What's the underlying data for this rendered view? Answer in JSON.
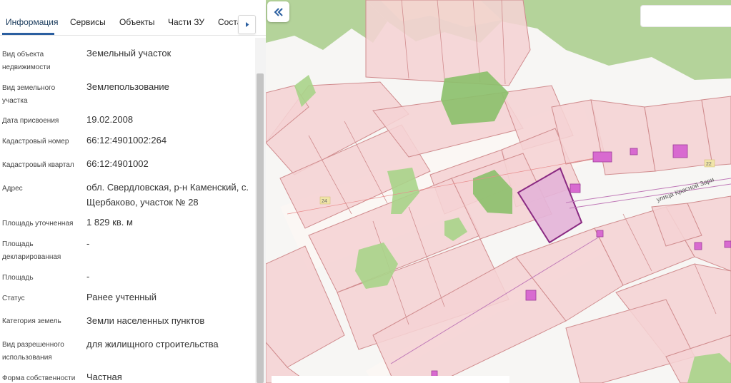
{
  "tabs": [
    {
      "label": "Информация"
    },
    {
      "label": "Сервисы"
    },
    {
      "label": "Объекты"
    },
    {
      "label": "Части ЗУ"
    },
    {
      "label": "Соста"
    }
  ],
  "properties": [
    {
      "label": "Вид объекта недвижимости",
      "value": "Земельный участок"
    },
    {
      "label": "Вид земельного участка",
      "value": "Землепользование"
    },
    {
      "label": "Дата присвоения",
      "value": "19.02.2008"
    },
    {
      "label": "Кадастровый номер",
      "value": "66:12:4901002:264"
    },
    {
      "label": "Кадастровый квартал",
      "value": "66:12:4901002"
    },
    {
      "label": "Адрес",
      "value": "обл. Свердловская, р-н Каменский, с. Щербаково, участок № 28"
    },
    {
      "label": "Площадь уточненная",
      "value": "1 829 кв. м"
    },
    {
      "label": "Площадь декларированная",
      "value": "-"
    },
    {
      "label": "Площадь",
      "value": "-"
    },
    {
      "label": "Статус",
      "value": "Ранее учтенный"
    },
    {
      "label": "Категория земель",
      "value": "Земли населенных пунктов"
    },
    {
      "label": "Вид разрешенного использования",
      "value": "для жилищного строительства"
    },
    {
      "label": "Форма собственности",
      "value": "Частная"
    }
  ],
  "map": {
    "street_label": "улица Красной Зари",
    "parcel_numbers": [
      "24",
      "22"
    ],
    "colors": {
      "parcel_fill": "#f5d3d4",
      "parcel_stroke": "#d08c8e",
      "selected_fill": "#e4b4d8",
      "selected_stroke": "#8a2a82",
      "building_fill": "#d86ad0",
      "forest_fill": "#8cc06c",
      "accent": "#2b5fa0"
    },
    "search_placeholder": ""
  },
  "icons": {
    "collapse": "double-chevron-left-icon",
    "tabs_next": "chevron-right-icon"
  }
}
